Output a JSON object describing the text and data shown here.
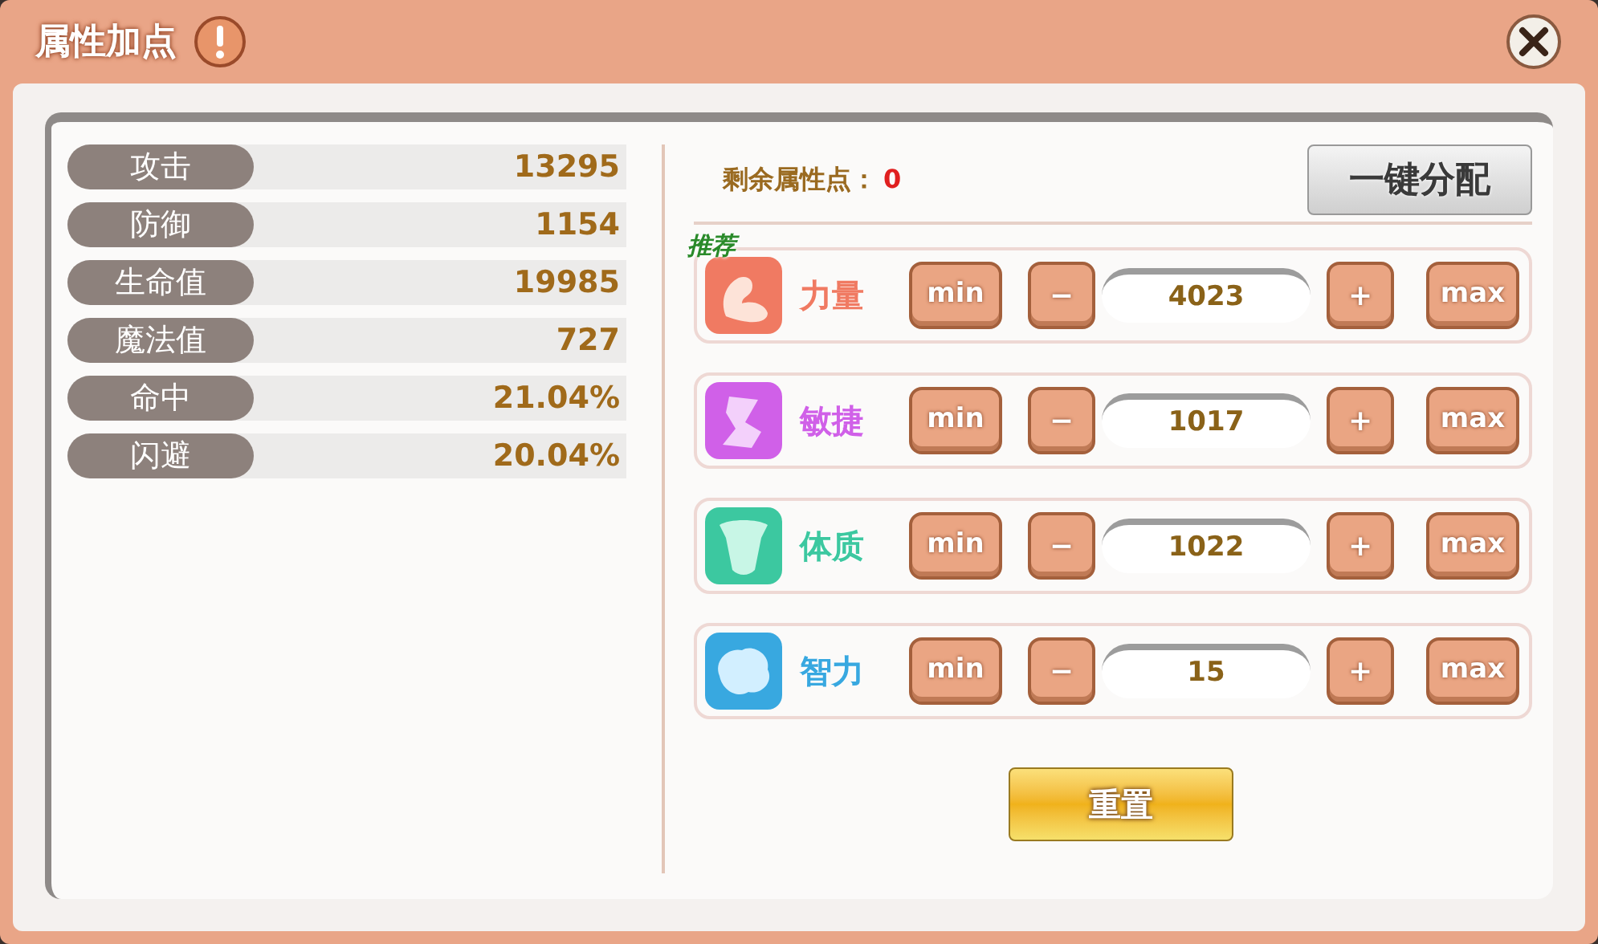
{
  "window": {
    "title": "属性加点"
  },
  "stats": [
    {
      "label": "攻击",
      "value": "13295"
    },
    {
      "label": "防御",
      "value": "1154"
    },
    {
      "label": "生命值",
      "value": "19985"
    },
    {
      "label": "魔法值",
      "value": "727"
    },
    {
      "label": "命中",
      "value": "21.04%"
    },
    {
      "label": "闪避",
      "value": "20.04%"
    }
  ],
  "remaining": {
    "label": "剩余属性点：",
    "value": "0"
  },
  "auto_assign_button": "一键分配",
  "attributes": [
    {
      "kind": "strength",
      "name": "力量",
      "color": "#f07a62",
      "badge": "推荐",
      "min": "min",
      "minus": "−",
      "value": "4023",
      "plus": "+",
      "max": "max"
    },
    {
      "kind": "agility",
      "name": "敏捷",
      "color": "#d060e8",
      "min": "min",
      "minus": "−",
      "value": "1017",
      "plus": "+",
      "max": "max"
    },
    {
      "kind": "constitution",
      "name": "体质",
      "color": "#3cc8a0",
      "min": "min",
      "minus": "−",
      "value": "1022",
      "plus": "+",
      "max": "max"
    },
    {
      "kind": "intellect",
      "name": "智力",
      "color": "#38a8e0",
      "min": "min",
      "minus": "−",
      "value": "15",
      "plus": "+",
      "max": "max"
    }
  ],
  "reset_button": "重置"
}
